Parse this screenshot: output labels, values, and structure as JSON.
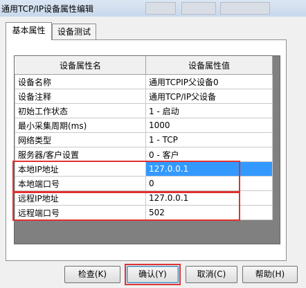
{
  "window": {
    "title": "通用TCP/IP设备属性编辑"
  },
  "tabs": [
    {
      "label": "基本属性"
    },
    {
      "label": "设备测试"
    }
  ],
  "grid": {
    "headers": [
      "设备属性名",
      "设备属性值"
    ],
    "rows": [
      {
        "name": "设备名称",
        "value": "通用TCPIP父设备0"
      },
      {
        "name": "设备注释",
        "value": "通用TCP/IP父设备"
      },
      {
        "name": "初始工作状态",
        "value": "1 - 启动"
      },
      {
        "name": "最小采集周期(ms)",
        "value": "1000"
      },
      {
        "name": "网络类型",
        "value": "1 - TCP"
      },
      {
        "name": "服务器/客户设置",
        "value": "0 - 客户"
      },
      {
        "name": "本地IP地址",
        "value": "127.0.0.1"
      },
      {
        "name": "本地端口号",
        "value": "0"
      },
      {
        "name": "远程IP地址",
        "value": "127.0.0.1"
      },
      {
        "name": "远程端口号",
        "value": "502"
      }
    ]
  },
  "buttons": {
    "check": "检查(K)",
    "confirm": "确认(Y)",
    "cancel": "取消(C)",
    "help": "帮助(H)"
  }
}
